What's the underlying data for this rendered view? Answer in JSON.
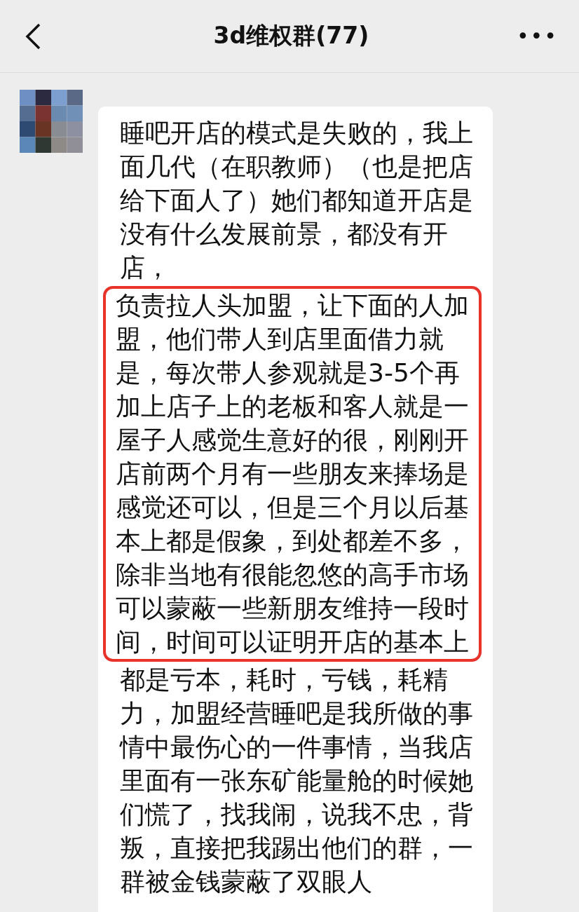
{
  "header": {
    "title": "3d维权群(77)",
    "more": "•••"
  },
  "message": {
    "segments": [
      {
        "highlighted": false,
        "text": "睡吧开店的模式是失败的，我上面几代（在职教师）（也是把店给下面人了）她们都知道开店是没有什么发展前景，都没有开店，"
      },
      {
        "highlighted": true,
        "text": "负责拉人头加盟，让下面的人加盟，他们带人到店里面借力就是，每次带人参观就是3-5个再加上店子上的老板和客人就是一屋子人感觉生意好的很，刚刚开店前两个月有一些朋友来捧场是感觉还可以，但是三个月以后基本上都是假象，到处都差不多，除非当地有很能忽悠的高手市场可以蒙蔽一些新朋友维持一段时间，时间可以证明开店的基本上"
      },
      {
        "highlighted": false,
        "text": "都是亏本，耗时，亏钱，耗精力，加盟经营睡吧是我所做的事情中最伤心的一件事情，当我店里面有一张东矿能量舱的时候她们慌了，找我闹，说我不忠，背叛，直接把我踢出他们的群，一群被金钱蒙蔽了双眼人"
      }
    ]
  }
}
